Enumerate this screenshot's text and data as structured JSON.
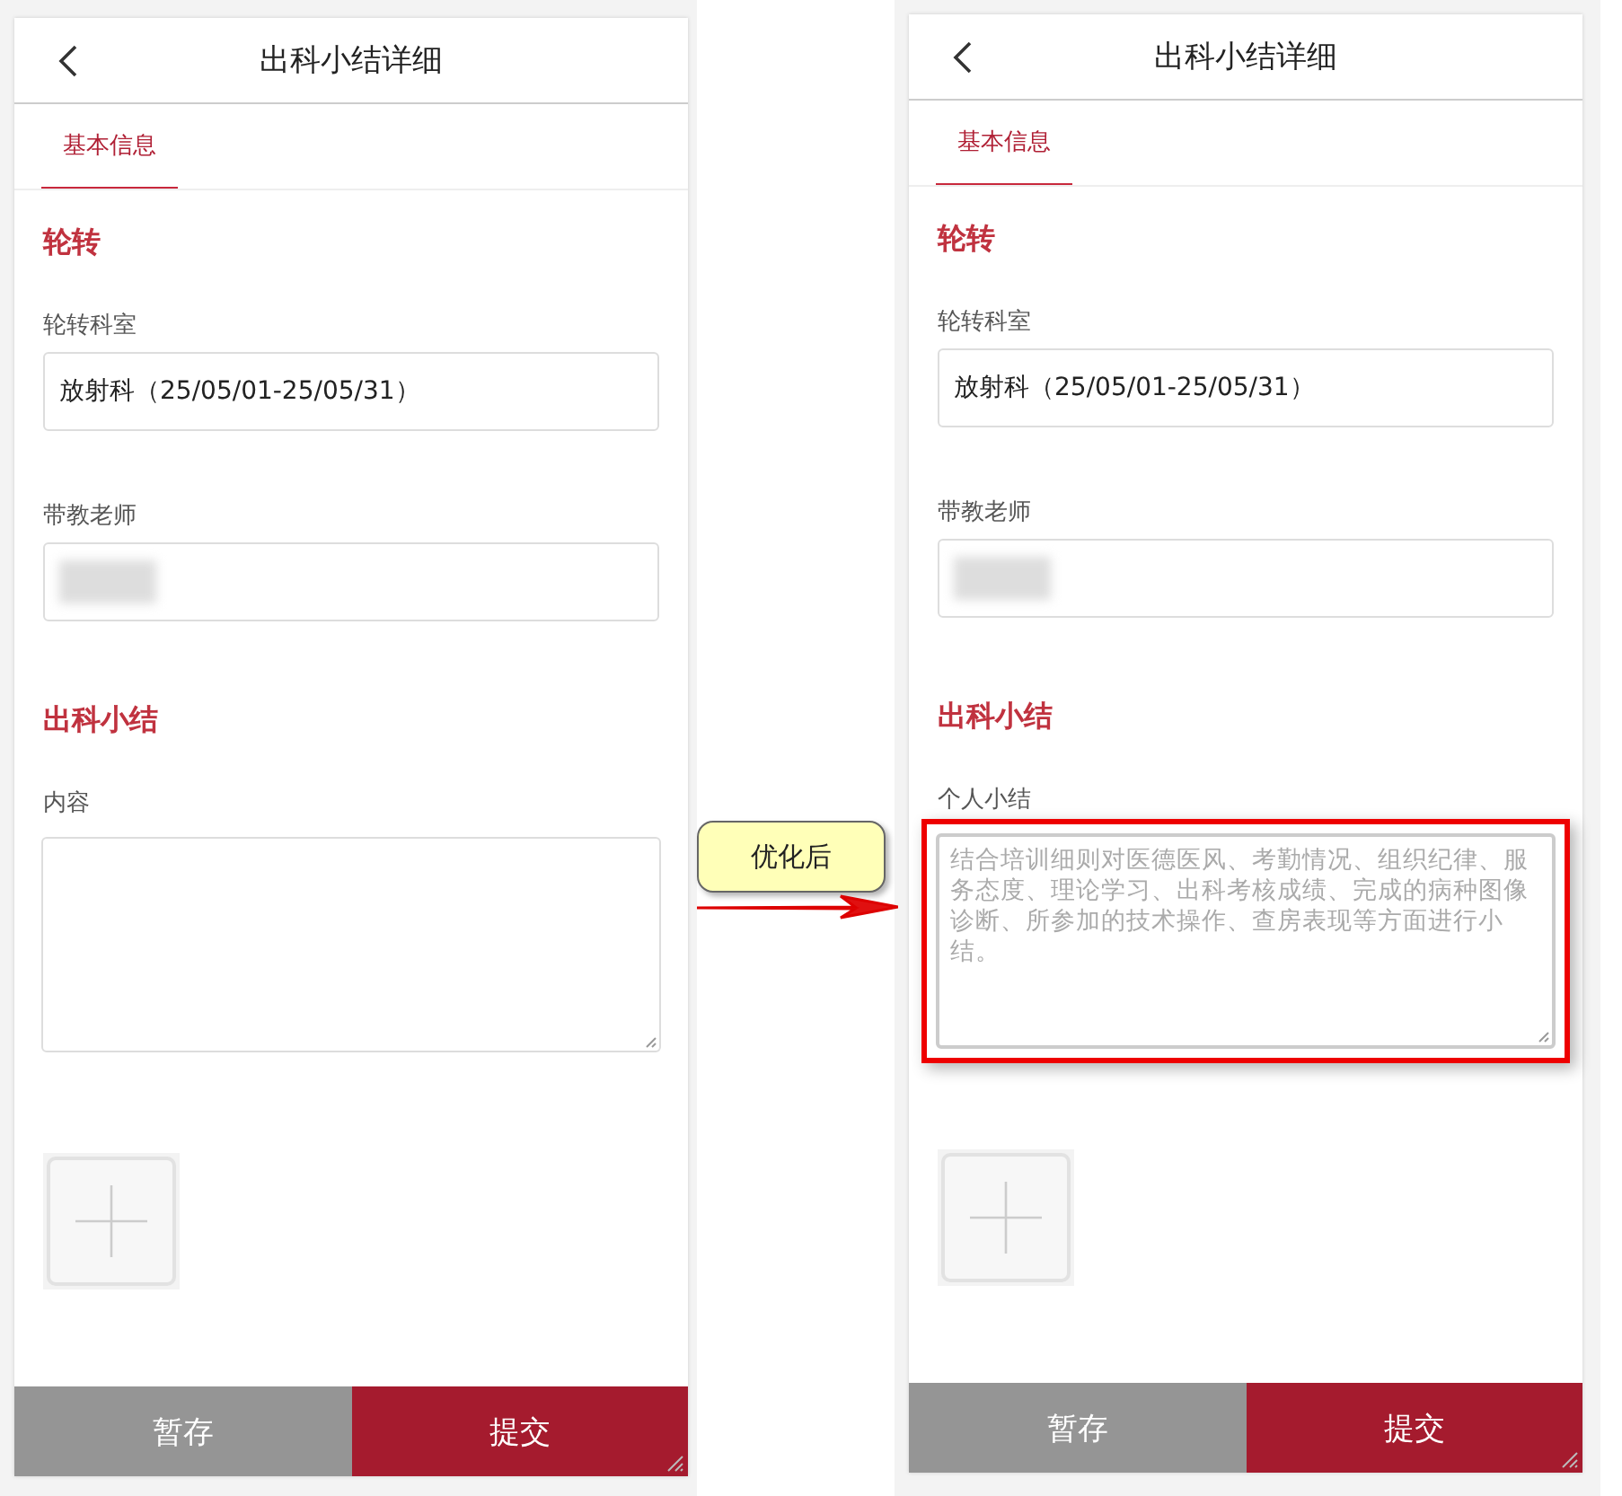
{
  "panels": [
    {
      "header": {
        "title": "出科小结详细"
      },
      "tabs": [
        {
          "label": "基本信息",
          "selected": true
        }
      ],
      "sections": [
        {
          "heading": "轮转",
          "fields": [
            {
              "label": "轮转科室",
              "kind": "text",
              "value": "放射科（25/05/01-25/05/31）"
            },
            {
              "label": "带教老师",
              "kind": "blurred"
            }
          ]
        },
        {
          "heading": "出科小结",
          "fields": [
            {
              "label": "内容",
              "kind": "textarea",
              "highlighted": false
            }
          ]
        }
      ],
      "buttons": [
        {
          "label": "暂存",
          "kind": "secondary"
        },
        {
          "label": "提交",
          "kind": "primary"
        }
      ]
    },
    {
      "header": {
        "title": "出科小结详细"
      },
      "tabs": [
        {
          "label": "基本信息",
          "selected": true
        }
      ],
      "sections": [
        {
          "heading": "轮转",
          "fields": [
            {
              "label": "轮转科室",
              "kind": "text",
              "value": "放射科（25/05/01-25/05/31）"
            },
            {
              "label": "带教老师",
              "kind": "blurred"
            }
          ]
        },
        {
          "heading": "出科小结",
          "fields": [
            {
              "label": "个人小结",
              "kind": "textarea",
              "highlighted": true,
              "placeholder": "结合培训细则对医德医风、考勤情况、组织纪律、服务态度、理论学习、出科考核成绩、完成的病种图像诊断、所参加的技术操作、查房表现等方面进行小结。"
            }
          ]
        }
      ],
      "buttons": [
        {
          "label": "暂存",
          "kind": "secondary"
        },
        {
          "label": "提交",
          "kind": "primary"
        }
      ]
    }
  ],
  "callout": {
    "label": "优化后"
  }
}
